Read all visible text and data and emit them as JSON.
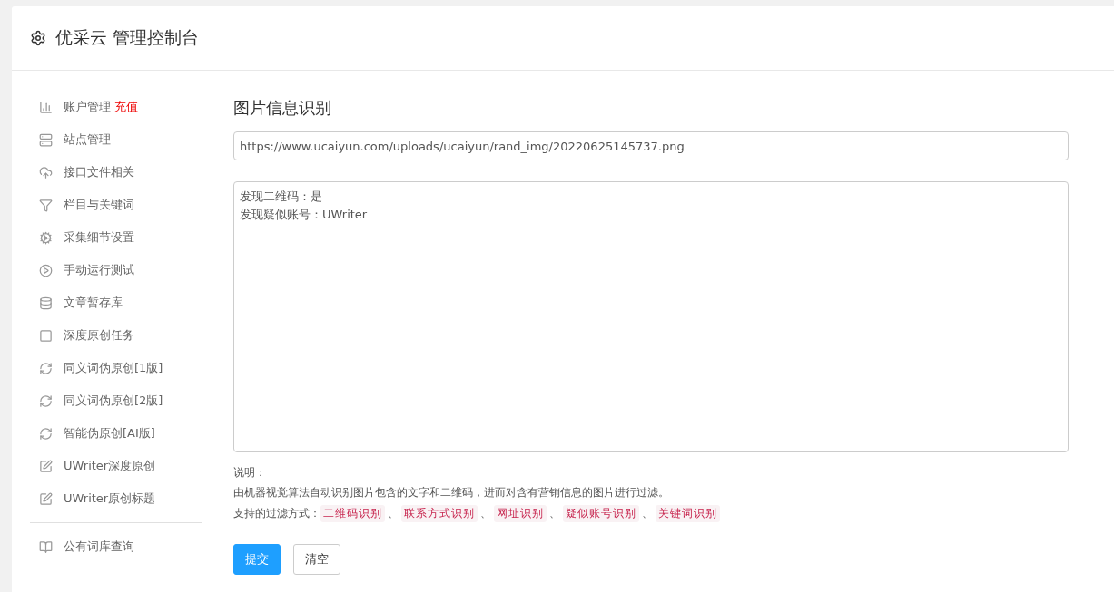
{
  "header": {
    "title": "优采云 管理控制台"
  },
  "sidebar": {
    "groups": [
      {
        "items": [
          {
            "label": "账户管理",
            "badge": "充值",
            "kind": "chart"
          },
          {
            "label": "站点管理",
            "kind": "server"
          },
          {
            "label": "接口文件相关",
            "kind": "cloud"
          },
          {
            "label": "栏目与关键词",
            "kind": "filter"
          },
          {
            "label": "采集细节设置",
            "kind": "cogs"
          },
          {
            "label": "手动运行测试",
            "kind": "play"
          },
          {
            "label": "文章暂存库",
            "kind": "database"
          },
          {
            "label": "深度原创任务",
            "kind": "square"
          },
          {
            "label": "同义词伪原创[1版]",
            "kind": "refresh"
          },
          {
            "label": "同义词伪原创[2版]",
            "kind": "refresh"
          },
          {
            "label": "智能伪原创[AI版]",
            "kind": "refresh"
          },
          {
            "label": "UWriter深度原创",
            "kind": "edit"
          },
          {
            "label": "UWriter原创标题",
            "kind": "edit"
          }
        ]
      },
      {
        "items": [
          {
            "label": "公有词库查询",
            "kind": "book"
          }
        ]
      }
    ]
  },
  "main": {
    "title": "图片信息识别",
    "url_field": {
      "value": "https://www.ucaiyun.com/uploads/ucaiyun/rand_img/20220625145737.png"
    },
    "result_box": {
      "lines": [
        "发现二维码：是",
        "发现疑似账号：UWriter"
      ]
    },
    "notes": {
      "heading": "说明：",
      "description": "由机器视觉算法自动识别图片包含的文字和二维码，进而对含有营销信息的图片进行过滤。",
      "methods_label": "支持的过滤方式：",
      "separator": "、",
      "methods": [
        "二维码识别",
        "联系方式识别",
        "网址识别",
        "疑似账号识别",
        "关键词识别"
      ]
    },
    "buttons": [
      {
        "label": "提交",
        "kind": "primary"
      },
      {
        "label": "清空",
        "kind": "default"
      }
    ]
  }
}
